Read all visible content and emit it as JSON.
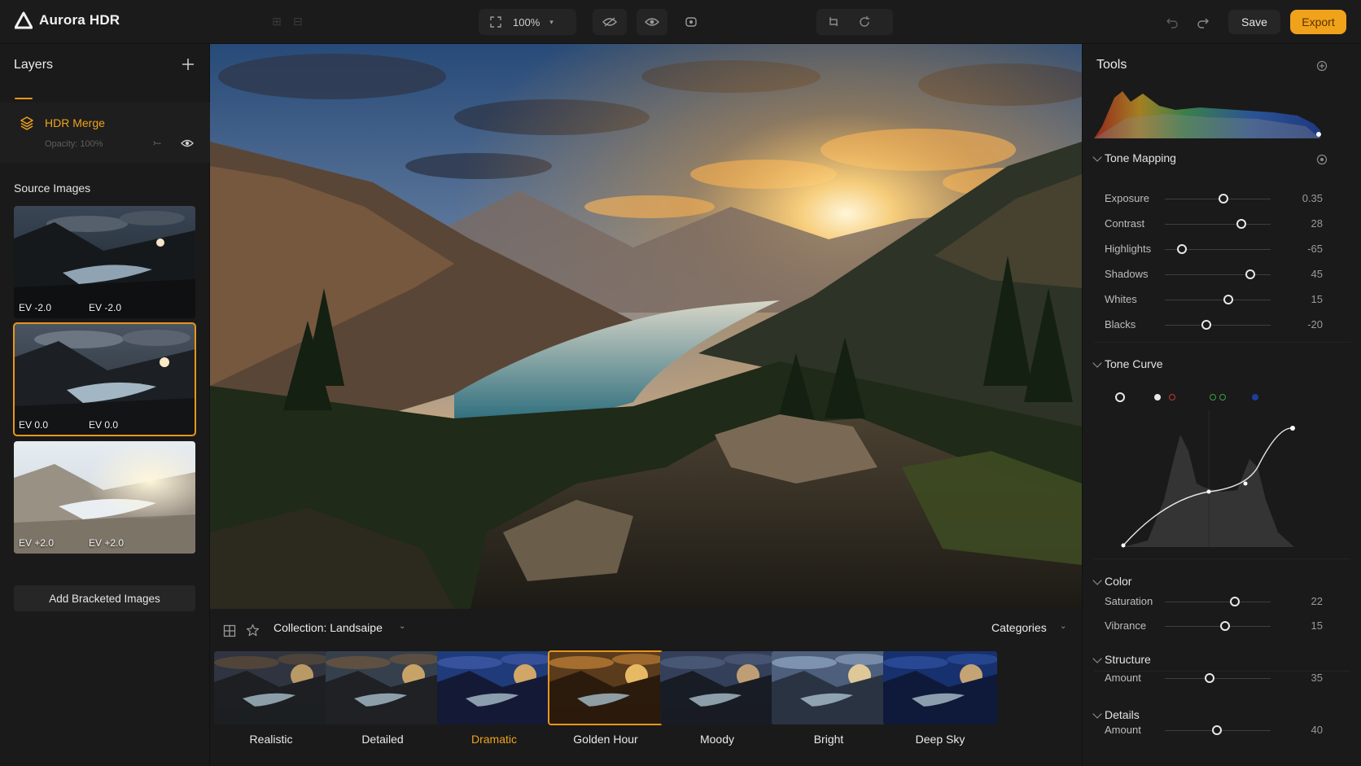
{
  "app": {
    "name": "Aurora HDR",
    "zoom": "100%",
    "save": "Save",
    "export": "Export"
  },
  "layers": {
    "title": "Layers",
    "item": {
      "name": "HDR Merge",
      "opacity": "Opacity: 100%"
    },
    "source_title": "Source Images",
    "sources": [
      {
        "left": "EV -2.0",
        "right": "EV -2.0"
      },
      {
        "left": "EV 0.0",
        "right": "EV 0.0"
      },
      {
        "left": "EV +2.0",
        "right": "EV +2.0"
      }
    ],
    "add_button": "Add Bracketed Images"
  },
  "presets": {
    "collection": "Collection: Landsaipe",
    "categories": "Categories",
    "items": [
      {
        "label": "Realistic"
      },
      {
        "label": "Detailed"
      },
      {
        "label": "Dramatic"
      },
      {
        "label": "Golden Hour"
      },
      {
        "label": "Moody"
      },
      {
        "label": "Bright"
      },
      {
        "label": "Deep Sky"
      }
    ]
  },
  "tools": {
    "title": "Tools",
    "tone_mapping": {
      "title": "Tone Mapping",
      "sliders": [
        {
          "name": "Exposure",
          "value": "0.35",
          "level": 0.55
        },
        {
          "name": "Contrast",
          "value": "28",
          "level": 0.72
        },
        {
          "name": "Highlights",
          "value": "-65",
          "level": 0.16
        },
        {
          "name": "Shadows",
          "value": "45",
          "level": 0.81
        },
        {
          "name": "Whites",
          "value": "15",
          "level": 0.6
        },
        {
          "name": "Blacks",
          "value": "-20",
          "level": 0.39
        }
      ]
    },
    "tone_curve": {
      "title": "Tone Curve"
    },
    "color": {
      "title": "Color",
      "sliders": [
        {
          "name": "Saturation",
          "value": "22",
          "level": 0.66
        },
        {
          "name": "Vibrance",
          "value": "15",
          "level": 0.57
        }
      ]
    },
    "structure": {
      "title": "Structure",
      "sliders": [
        {
          "name": "Amount",
          "value": "35",
          "level": 0.42
        }
      ]
    },
    "details": {
      "title": "Details",
      "sliders": [
        {
          "name": "Amount",
          "value": "40",
          "level": 0.49
        }
      ]
    }
  },
  "colors": {
    "accent": "#f0a21a",
    "panel": "#1a1a1a",
    "topbar": "#1b1b1b"
  }
}
